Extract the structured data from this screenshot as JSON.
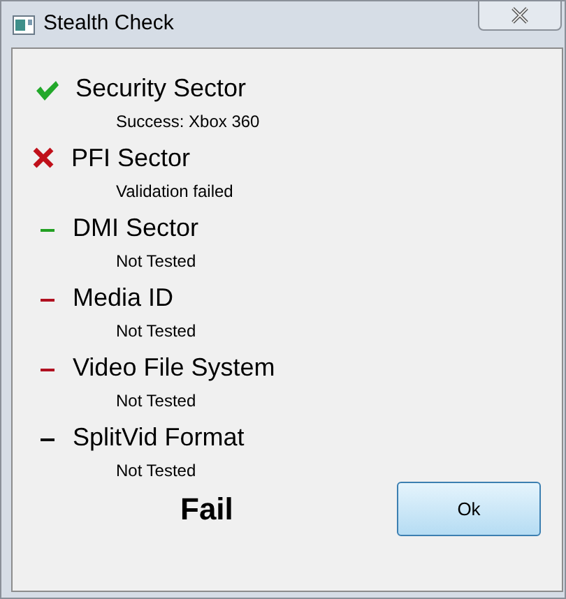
{
  "window": {
    "title": "Stealth Check"
  },
  "checks": [
    {
      "name": "Security Sector",
      "kind": "pass",
      "result": "Success: Xbox 360"
    },
    {
      "name": "PFI Sector",
      "kind": "fail",
      "result": "Validation failed"
    },
    {
      "name": "DMI Sector",
      "kind": "untested",
      "color": "#22a022",
      "result": "Not Tested"
    },
    {
      "name": "Media ID",
      "kind": "untested",
      "color": "#b01020",
      "result": "Not Tested"
    },
    {
      "name": "Video File System",
      "kind": "untested",
      "color": "#b01020",
      "result": "Not Tested"
    },
    {
      "name": "SplitVid Format",
      "kind": "untested",
      "color": "#101010",
      "result": "Not Tested"
    }
  ],
  "verdict": "Fail",
  "ok_button": "Ok"
}
